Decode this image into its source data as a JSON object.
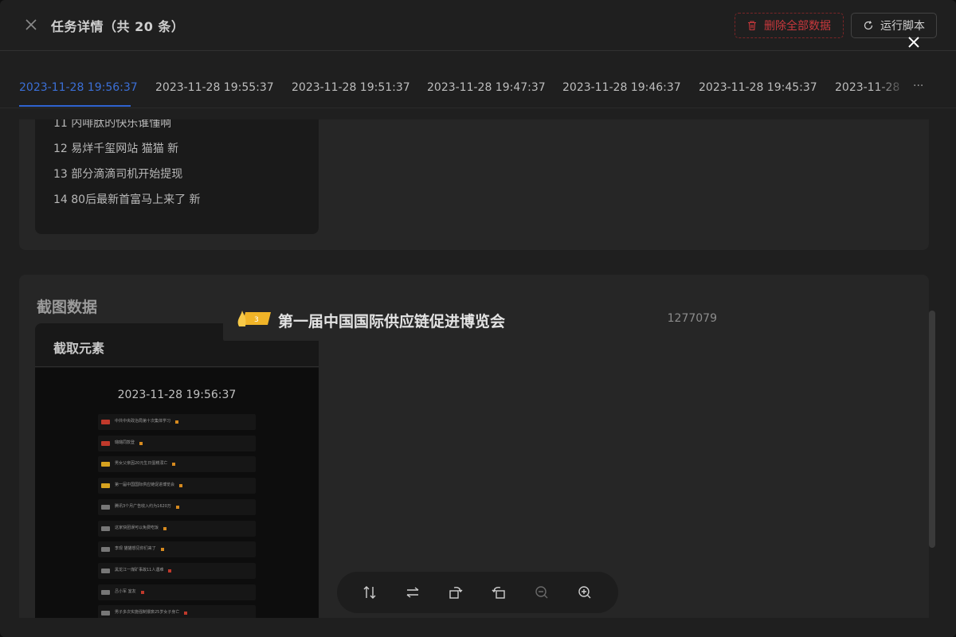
{
  "header": {
    "title": "任务详情（共 20 条）",
    "delete_all_label": "删除全部数据",
    "run_script_label": "运行脚本"
  },
  "tabs": {
    "items": [
      {
        "label": "2023-11-28 19:56:37",
        "active": true
      },
      {
        "label": "2023-11-28 19:55:37",
        "active": false
      },
      {
        "label": "2023-11-28 19:51:37",
        "active": false
      },
      {
        "label": "2023-11-28 19:47:37",
        "active": false
      },
      {
        "label": "2023-11-28 19:46:37",
        "active": false
      },
      {
        "label": "2023-11-28 19:45:37",
        "active": false
      },
      {
        "label": "2023-11-28",
        "active": false
      }
    ],
    "more_label": "···"
  },
  "list": {
    "items": [
      "11 内啡肽的快乐谁懂啊",
      "12 易烊千玺网站 猫猫 新",
      "13 部分滴滴司机开始提现",
      "14 80后最新首富马上来了 新"
    ]
  },
  "screenshot_section": {
    "title": "截图数据",
    "element_label": "截取元素",
    "timestamp": "2023-11-28 19:56:37",
    "mini_rows": [
      {
        "text": "中共中央政治局第十次集体学习",
        "icon_color": "#c0392b",
        "tag_color": "#d68a1f"
      },
      {
        "text": "璐璐同款登",
        "icon_color": "#c0392b",
        "tag_color": "#d68a1f"
      },
      {
        "text": "男女父亲因20元生日蛋糕溺亡",
        "icon_color": "#d6a21f",
        "tag_color": "#d68a1f"
      },
      {
        "text": "第一届中国国际供应链促进博览会",
        "icon_color": "#d6a21f",
        "tag_color": "#d68a1f"
      },
      {
        "text": "腾讯3个月广告收入约为1620万",
        "icon_color": "#777777",
        "tag_color": "#d68a1f"
      },
      {
        "text": "这家快团误可以免费吃饭",
        "icon_color": "#777777",
        "tag_color": "#d68a1f"
      },
      {
        "text": "李现 猫猫想见你们来了",
        "icon_color": "#777777",
        "tag_color": "#d68a1f"
      },
      {
        "text": "黑龙江一煤矿事故11人遇难",
        "icon_color": "#777777",
        "tag_color": "#c0392b"
      },
      {
        "text": "吕小军 室友",
        "icon_color": "#777777",
        "tag_color": "#c0392b"
      },
      {
        "text": "男子多次实施强制猥亵25岁女子身亡",
        "icon_color": "#777777",
        "tag_color": "#c0392b"
      }
    ]
  },
  "preview": {
    "banner_title": "第一届中国国际供应链促进博览会",
    "banner_count": "1277079",
    "tools": [
      "flip-vertical-icon",
      "flip-horizontal-icon",
      "rotate-right-icon",
      "rotate-left-icon",
      "zoom-out-icon",
      "zoom-in-icon"
    ]
  },
  "colors": {
    "accent": "#2f63d1",
    "danger": "#c8383c",
    "banner_icon": "#f0b428"
  }
}
